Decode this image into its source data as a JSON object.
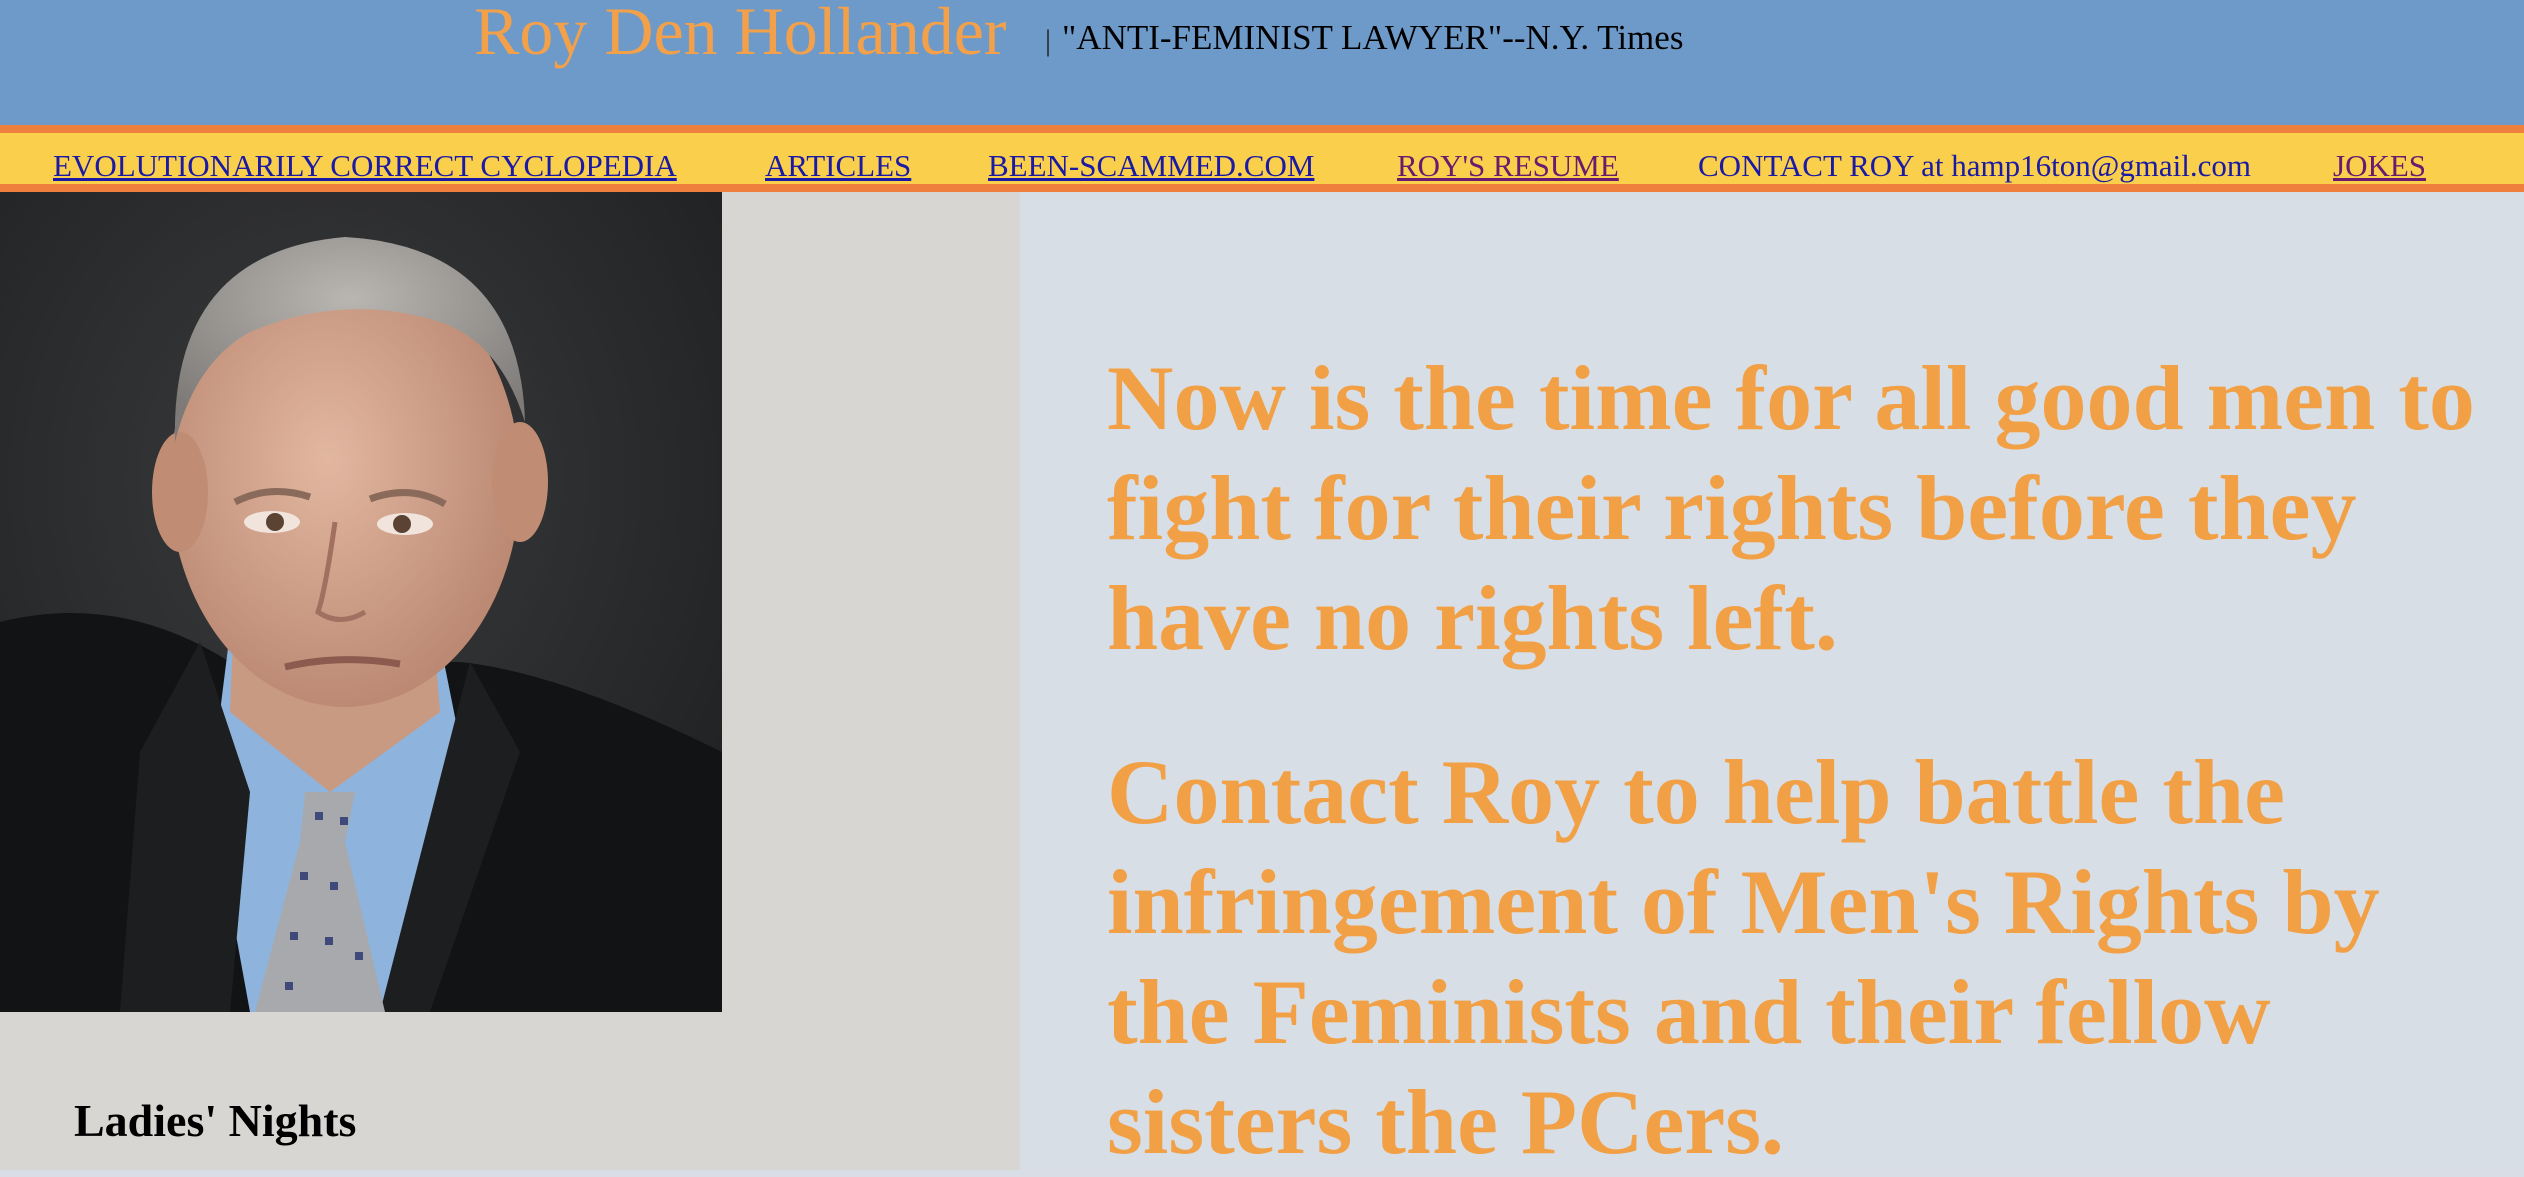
{
  "header": {
    "site_title": "Roy Den Hollander",
    "separator": "|",
    "tagline": "\"ANTI-FEMINIST LAWYER\"--N.Y. Times"
  },
  "nav": {
    "items": [
      {
        "label": "EVOLUTIONARILY CORRECT CYCLOPEDIA "
      },
      {
        "label": "ARTICLES"
      },
      {
        "label": "BEEN-SCAMMED.COM"
      },
      {
        "label": "ROY'S RESUME"
      },
      {
        "label": "CONTACT ROY at hamp16ton@gmail.com"
      },
      {
        "label": "JOKES"
      }
    ]
  },
  "sidebar": {
    "photo_icon": "portrait-photo",
    "heading": "Ladies' Nights"
  },
  "main": {
    "message_1": "Now is the time for all good men to fight for their rights before they have no rights left.",
    "message_2": "Contact Roy to help battle the infringement of Men's Rights by the Feminists and their fellow sisters the PCers."
  },
  "colors": {
    "header_bg": "#6e9ac9",
    "nav_bg": "#f9cf4b",
    "nav_border": "#ee7f3c",
    "accent_orange": "#f2a045",
    "link_blue": "#1a1aa6",
    "link_visited": "#6b1a6e"
  }
}
